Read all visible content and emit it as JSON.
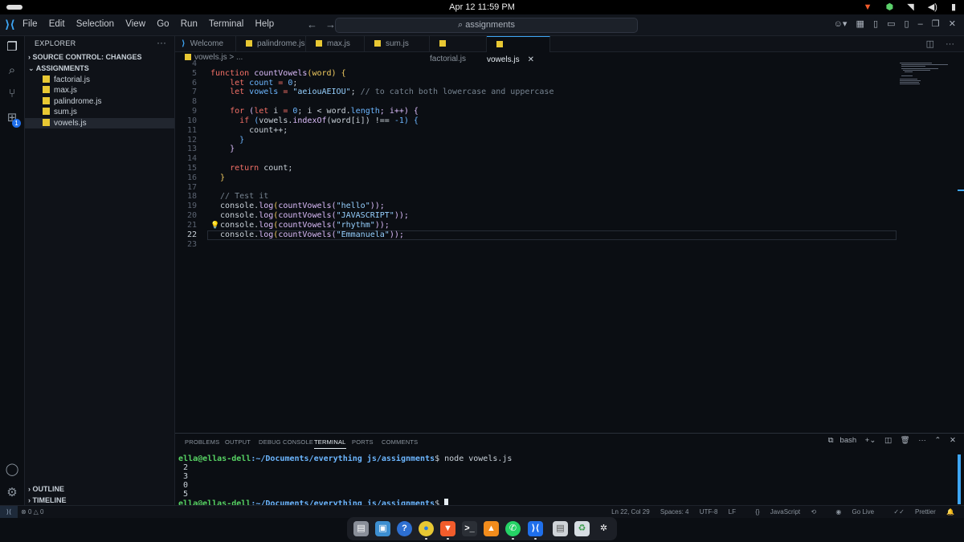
{
  "topbar": {
    "clock": "Apr 12  11:59 PM"
  },
  "titlebar": {
    "menus": [
      "File",
      "Edit",
      "Selection",
      "View",
      "Go",
      "Run",
      "Terminal",
      "Help"
    ],
    "search": "assignments"
  },
  "sidebar": {
    "title": "EXPLORER",
    "source_control": "SOURCE CONTROL: CHANGES",
    "folder": "ASSIGNMENTS",
    "files": [
      "factorial.js",
      "max.js",
      "palindrome.js",
      "sum.js",
      "vowels.js"
    ],
    "selected_file": "vowels.js",
    "outline": "OUTLINE",
    "timeline": "TIMELINE"
  },
  "activity_badge": "1",
  "tabs": [
    "Welcome",
    "palindrome.js",
    "max.js",
    "sum.js",
    "factorial.js",
    "vowels.js"
  ],
  "active_tab": "vowels.js",
  "breadcrumb": "vowels.js > ...",
  "line_numbers": [
    "4",
    "5",
    "6",
    "7",
    "8",
    "9",
    "10",
    "11",
    "12",
    "13",
    "14",
    "15",
    "16",
    "17",
    "18",
    "19",
    "20",
    "21",
    "22",
    "23"
  ],
  "code": {
    "l5a": "function ",
    "l5b": "countVowels",
    "l5c": "(word) {",
    "l6a": "    let ",
    "l6b": "count",
    "l6c": " = ",
    "l6d": "0",
    "l6e": ";",
    "l7a": "    let ",
    "l7b": "vowels",
    "l7c": " = ",
    "l7d": "\"aeiouAEIOU\"",
    "l7e": "; ",
    "l7f": "// to catch both lowercase and uppercase",
    "l9a": "    for ",
    "l9b": "(",
    "l9c": "let ",
    "l9d": "i",
    "l9e": " = ",
    "l9f": "0",
    "l9g": "; i < word.",
    "l9h": "length",
    "l9i": "; i++) {",
    "l10a": "      if ",
    "l10b": "(",
    "l10c": "vowels.",
    "l10d": "indexOf",
    "l10e": "(word[i]) !== ",
    "l10f": "-1",
    "l10g": ") {",
    "l11": "        count++;",
    "l12": "      }",
    "l13": "    }",
    "l15a": "    return ",
    "l15b": "count;",
    "l16": "  }",
    "l18": "  // Test it",
    "l19a": "  console.",
    "l19b": "log",
    "l19c": "(",
    "l19d": "countVowels",
    "l19e": "(",
    "l19f": "\"hello\"",
    "l19g": "));",
    "l20f": "\"JAVASCRIPT\"",
    "l21f": "\"rhythm\"",
    "l22f": "\"Emmanuela\""
  },
  "panel": {
    "tabs": [
      "PROBLEMS",
      "OUTPUT",
      "DEBUG CONSOLE",
      "TERMINAL",
      "PORTS",
      "COMMENTS"
    ],
    "active_tab": "TERMINAL",
    "shell": "bash",
    "prompt_user": "ella@ellas-dell",
    "prompt_path": ":~/Documents/everything js/assignments",
    "prompt_end": "$ ",
    "command": "node vowels.js",
    "outputs": [
      "2",
      "3",
      "0",
      "5"
    ]
  },
  "status": {
    "errors": "0",
    "warnings": "0",
    "position": "Ln 22, Col 29",
    "spaces": "Spaces: 4",
    "encoding": "UTF-8",
    "eol": "LF",
    "language": "JavaScript",
    "golive": "Go Live",
    "prettier": "Prettier"
  },
  "colors": {
    "accent": "#3ea6f5",
    "js_icon": "#e8c833",
    "prompt_green": "#57d364"
  },
  "dock_icons": [
    "files-icon",
    "store-icon",
    "help-icon",
    "chrome-icon",
    "brave-icon",
    "terminal-icon",
    "vlc-icon",
    "whatsapp-icon",
    "vscode-icon",
    "document-icon",
    "trash-icon",
    "apps-grid-icon"
  ]
}
